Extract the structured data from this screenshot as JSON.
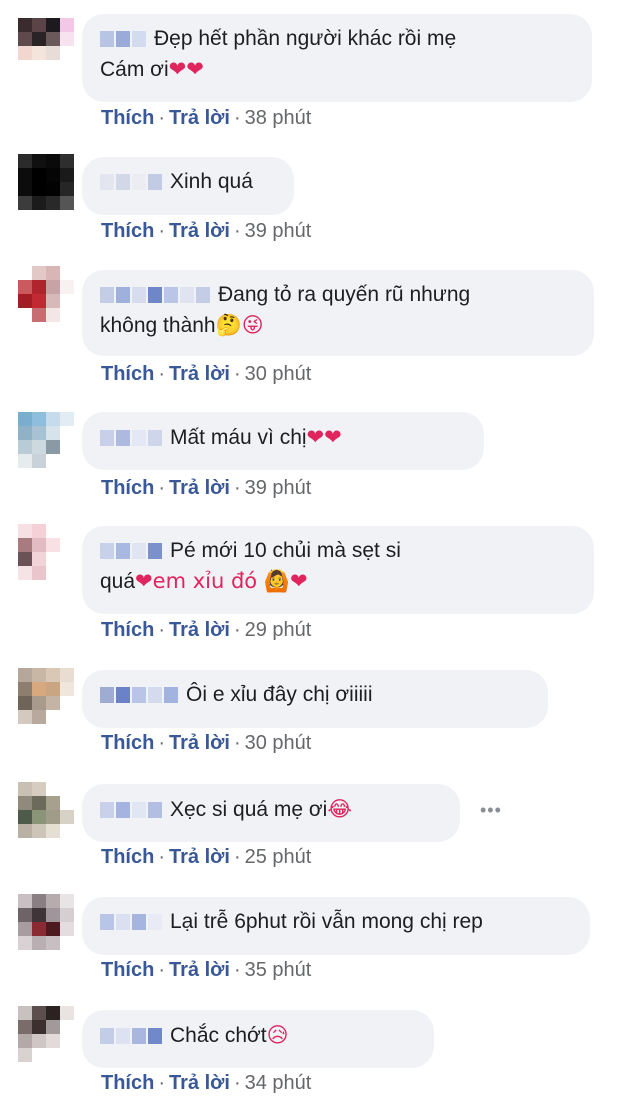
{
  "actions": {
    "like": "Thích",
    "reply": "Trả lời",
    "separator": "·"
  },
  "comments": [
    {
      "text": "Đẹp hết phần người khác rồi mẹ\nCám ơi",
      "trail": "❤❤",
      "time": "38 phút",
      "avatar": [
        "#3a2b2e",
        "#5a4448",
        "#1d1a1f",
        "#f3c7e6",
        "#5e4a4c",
        "#2a2326",
        "#6a585b",
        "#f7e3f0",
        "#f1d7cf",
        "#f5e4dc",
        "#e8dcd8",
        "#fff",
        "#fff",
        "#fff",
        "#fff",
        "#fff"
      ],
      "blur": [
        "#b8c4e3",
        "#9aabd9",
        "#d3dbef"
      ]
    },
    {
      "text": "Xinh quá",
      "trail": "",
      "time": "39 phút",
      "avatar": [
        "#2b2b2b",
        "#101010",
        "#0a0a0a",
        "#2e2e2e",
        "#0c0c0c",
        "#000",
        "#050505",
        "#1a1a1a",
        "#0c0c0c",
        "#000",
        "#020202",
        "#262626",
        "#3c3c3c",
        "#1b1b1b",
        "#292929",
        "#555"
      ],
      "blur": [
        "#e3e6ef",
        "#d3d8e8",
        "#ecedf3",
        "#c2cbe4"
      ]
    },
    {
      "text": "Đang tỏ ra quyến rũ nhưng\nkhông thành",
      "trail": "🤔😜",
      "time": "30 phút",
      "avatar": [
        "#fff",
        "#e3c8c8",
        "#d9b5b5",
        "#fff",
        "#c95b5f",
        "#b0252b",
        "#c8a3a5",
        "#f7f1f1",
        "#a21e24",
        "#c12a31",
        "#d8b9ba",
        "#fff",
        "#fff",
        "#c86e72",
        "#f2e6e6",
        "#fff"
      ],
      "blur": [
        "#c3cde6",
        "#9fb0dc",
        "#d7ddee",
        "#6f86c8",
        "#bac6e6",
        "#e0e4f1",
        "#c5cde6"
      ]
    },
    {
      "text": "Mất máu vì chị",
      "trail": "❤❤",
      "time": "39 phút",
      "avatar": [
        "#79aecf",
        "#8fbedc",
        "#c6dced",
        "#e2ecf4",
        "#8fb2c7",
        "#a7c2d3",
        "#d7e3ea",
        "#fff",
        "#b9cbd6",
        "#cdd8df",
        "#8a9aa5",
        "#fff",
        "#e6ebee",
        "#c9d2d8",
        "#fff",
        "#fff"
      ],
      "blur": [
        "#c7d0e8",
        "#aeb9df",
        "#e4e8f4",
        "#cfd6ec"
      ]
    },
    {
      "text": "Pé mới 10 chủi mà sẹt si\nquá",
      "trail": "❤em xỉu đó 🙆❤",
      "time": "29 phút",
      "avatar": [
        "#f6e0e3",
        "#f3d1d6",
        "#fff",
        "#fff",
        "#a87b80",
        "#e1bcc2",
        "#f8e0e5",
        "#fff",
        "#6b5257",
        "#f0d4d8",
        "#fff",
        "#fff",
        "#f5e3e6",
        "#e8c6cb",
        "#fff",
        "#fff"
      ],
      "blur": [
        "#c8d1ea",
        "#a9b8e0",
        "#e1e5f3",
        "#7c91cc"
      ]
    },
    {
      "text": "Ôi e xỉu đây chị ơiiiii",
      "trail": "",
      "time": "30 phút",
      "avatar": [
        "#b5a89a",
        "#c9b7a5",
        "#d9c8b6",
        "#e9ddd2",
        "#8d7e70",
        "#d8a97e",
        "#caa582",
        "#f0e6dc",
        "#6f6458",
        "#a89a8c",
        "#c3b4a6",
        "#fff",
        "#d3c9bf",
        "#b7aa9d",
        "#fff",
        "#fff"
      ],
      "blur": [
        "#9eabd2",
        "#6b82c9",
        "#b8c5e6",
        "#d4dbef",
        "#a2b3df"
      ]
    },
    {
      "text": "Xẹc si quá mẹ ơi",
      "trail": "😂",
      "time": "25 phút",
      "avatar": [
        "#c9c0b4",
        "#d6ccbf",
        "#fff",
        "#fff",
        "#8f8a7c",
        "#6c6a5b",
        "#a7a08f",
        "#fff",
        "#4e5a4a",
        "#8a9478",
        "#a19c8a",
        "#d7d1c6",
        "#b9b2a4",
        "#cdc6b8",
        "#e5ded3",
        "#fff"
      ],
      "blur": [
        "#c9d1ea",
        "#a4b3df",
        "#e1e6f3",
        "#b2bfe3"
      ]
    },
    {
      "text": "Lại trễ 6phut rồi vẫn mong chị rep",
      "trail": "",
      "time": "35 phút",
      "avatar": [
        "#c8c0c2",
        "#8a7f83",
        "#b6acae",
        "#e8e3e4",
        "#6e6367",
        "#3f3539",
        "#a0959a",
        "#d6ced0",
        "#a79da0",
        "#8a2a33",
        "#4d1a20",
        "#e4dcde",
        "#d9d2d4",
        "#b9afb2",
        "#c7bfc1",
        "#fff"
      ],
      "blur": [
        "#b9c5e6",
        "#dae0f1",
        "#a6b5df",
        "#e8ebf5"
      ]
    },
    {
      "text": "Chắc chớt",
      "trail": "😥",
      "time": "34 phút",
      "avatar": [
        "#c7c1bf",
        "#5b4e4d",
        "#2d2222",
        "#e9e3e2",
        "#7a6c6b",
        "#3c2f2f",
        "#a1999a",
        "#fff",
        "#b2a9a8",
        "#cfc6c5",
        "#e2dbda",
        "#fff",
        "#d8d2d1",
        "#fff",
        "#fff",
        "#fff"
      ],
      "blur": [
        "#c4cde8",
        "#dde2f2",
        "#a9b7de",
        "#7189cb"
      ]
    }
  ]
}
